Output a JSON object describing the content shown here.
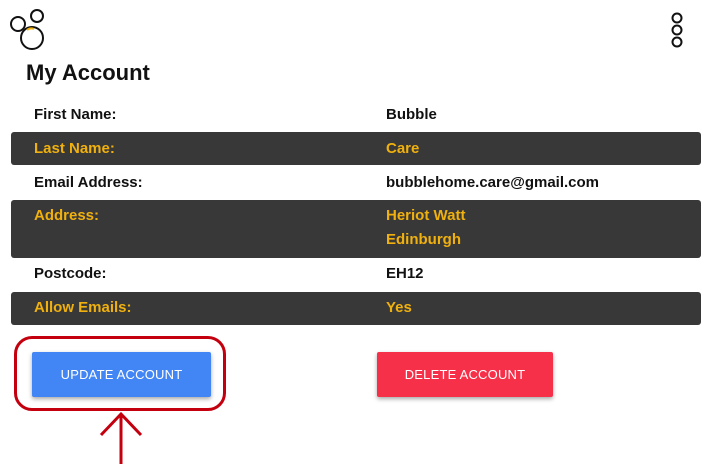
{
  "colors": {
    "dark_row": "#383838",
    "accent": "#f0b00e",
    "update_button": "#4285f4",
    "delete_button": "#f7304a",
    "annotation_red": "#c4000f"
  },
  "header": {
    "logo_icon": "bubbles-icon",
    "menu_icon": "vertical-circles-menu-icon"
  },
  "page": {
    "title": "My Account"
  },
  "account": {
    "first_name_label": "First Name:",
    "first_name": "Bubble",
    "last_name_label": "Last Name:",
    "last_name": "Care",
    "email_label": "Email Address:",
    "email": "bubblehome.care@gmail.com",
    "address_label": "Address:",
    "address_line1": "Heriot Watt",
    "address_line2": "Edinburgh",
    "postcode_label": "Postcode:",
    "postcode": "EH12",
    "allow_emails_label": "Allow Emails:",
    "allow_emails": "Yes"
  },
  "actions": {
    "update_label": "UPDATE ACCOUNT",
    "delete_label": "DELETE ACCOUNT"
  }
}
